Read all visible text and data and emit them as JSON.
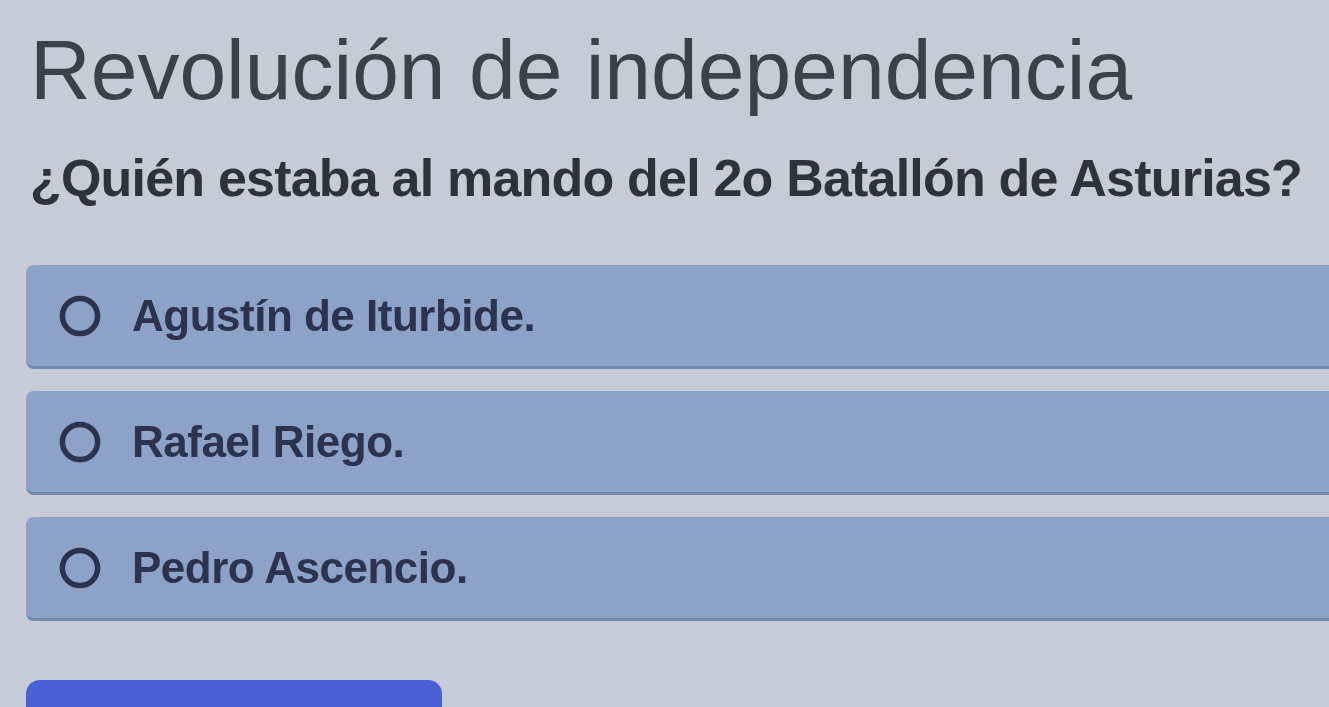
{
  "heading": "Revolución de independencia",
  "question": "¿Quién estaba al mando del 2o Batallón de Asturias?",
  "options": [
    {
      "label": "Agustín de Iturbide.",
      "selected": false
    },
    {
      "label": "Rafael Riego.",
      "selected": false
    },
    {
      "label": "Pedro Ascencio.",
      "selected": false
    }
  ]
}
